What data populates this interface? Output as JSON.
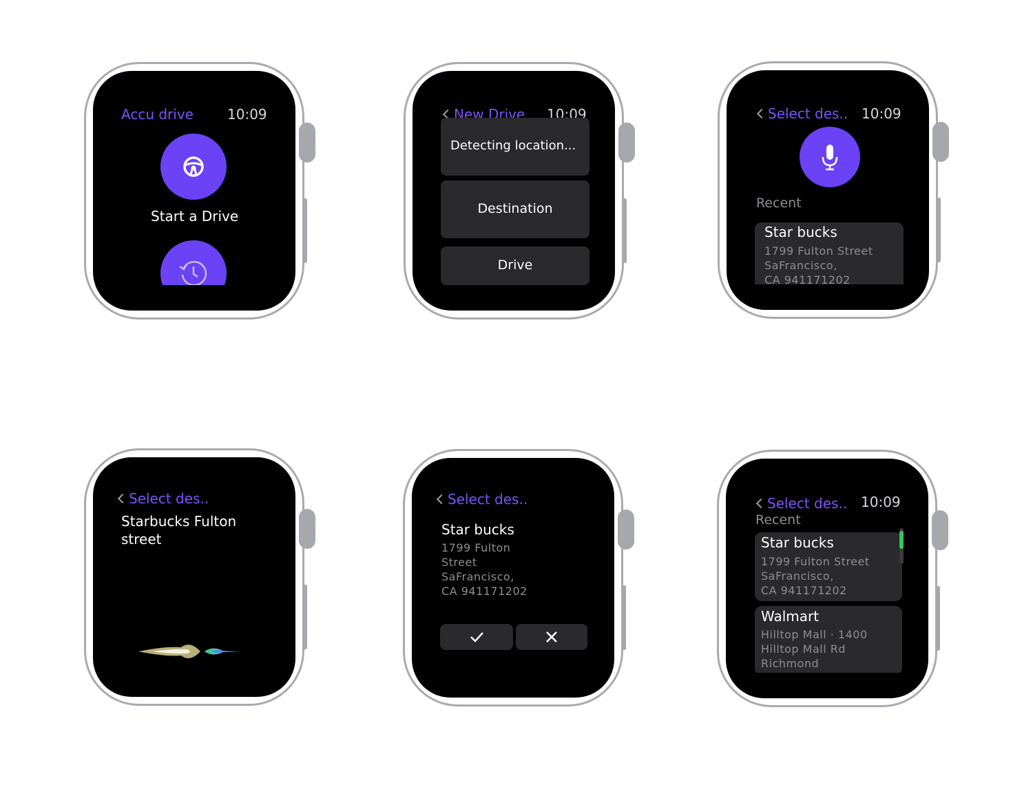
{
  "watch1": {
    "title": "Accu drive",
    "time": "10:09",
    "start_label": "Start a Drive",
    "start_icon": "steering-wheel-icon",
    "history_icon": "history-icon"
  },
  "watch2": {
    "title": "New Drive",
    "time": "10:09",
    "items": [
      "Detecting location...",
      "Destination",
      "Drive"
    ]
  },
  "watch3": {
    "title": "Select des..",
    "time": "10:09",
    "mic_icon": "microphone-icon",
    "recent_label": "Recent",
    "recent": [
      {
        "name": "Star bucks",
        "line1": "1799 Fulton Street",
        "line2": "SaFrancisco,",
        "line3": "CA 941171202"
      }
    ]
  },
  "watch4": {
    "title": "Select des..",
    "dictation": "Starbucks Fulton street",
    "waveform_icon": "siri-waveform-icon"
  },
  "watch5": {
    "title": "Select des..",
    "place_name": "Star bucks",
    "address": [
      "1799 Fulton",
      "Street",
      "SaFrancisco,",
      "CA 941171202"
    ],
    "confirm_icon": "checkmark-icon",
    "cancel_icon": "close-icon"
  },
  "watch6": {
    "title": "Select des..",
    "time": "10:09",
    "recent_label": "Recent",
    "recent": [
      {
        "name": "Star bucks",
        "line1": "1799 Fulton Street",
        "line2": "SaFrancisco,",
        "line3": "CA 941171202"
      },
      {
        "name": "Walmart",
        "line1": "Hilltop Mall · 1400",
        "line2": "Hilltop Mall Rd",
        "line3": "Richmond"
      }
    ],
    "scroll_indicator_color": "#34c759"
  },
  "colors": {
    "accent": "#6b42f5",
    "title": "#7b52ff",
    "card": "#2a2a2c",
    "watch_case": "#a9a9b0"
  }
}
